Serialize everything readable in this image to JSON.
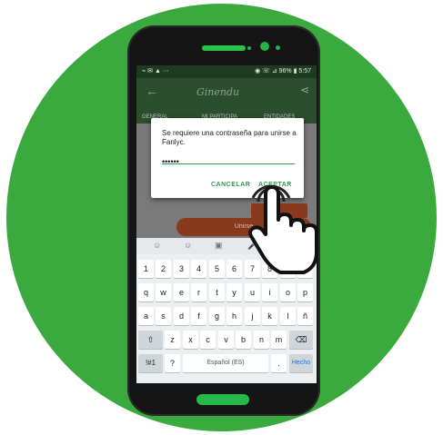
{
  "status_bar": {
    "left_icons": "⌁ ✉ ▲ ···",
    "right": "◉ ☏ ⊿ 96% ▮ 5:57"
  },
  "app": {
    "logo": "Ginendu",
    "back_icon": "←",
    "share_icon": "⋖"
  },
  "tabs": [
    "GENERAL",
    "MI PARTICIPA",
    "ENTIDADES"
  ],
  "join_button": "Unirse",
  "dialog": {
    "message": "Se requiere una contraseña para unirse a Fanlyc.",
    "password_value": "••••••",
    "cancel_label": "CANCELAR",
    "accept_label": "ACEPTAR"
  },
  "keyboard": {
    "suggestion_icons": [
      "☺",
      "☺",
      "▣",
      "🎤",
      "⚙"
    ],
    "row_numbers": [
      "1",
      "2",
      "3",
      "4",
      "5",
      "6",
      "7",
      "8",
      "9",
      "0"
    ],
    "row1": [
      "q",
      "w",
      "e",
      "r",
      "t",
      "y",
      "u",
      "i",
      "o",
      "p"
    ],
    "row2": [
      "a",
      "s",
      "d",
      "f",
      "g",
      "h",
      "j",
      "k",
      "l",
      "ñ"
    ],
    "row3": [
      "z",
      "x",
      "c",
      "v",
      "b",
      "n",
      "m"
    ],
    "shift": "⇧",
    "backspace": "⌫",
    "symbols": "!#1",
    "question": "?",
    "space": "Español (ES)",
    "period": ".",
    "done": "Hecho"
  },
  "colors": {
    "background_circle": "#3aaa3f",
    "accent": "#2e9e4a",
    "app_bar": "#2b4e2d"
  }
}
